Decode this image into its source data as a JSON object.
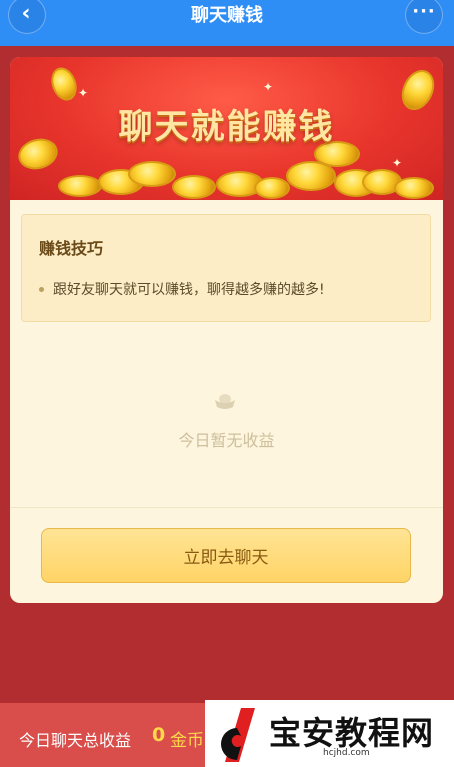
{
  "header": {
    "title": "聊天赚钱",
    "back_icon": "chevron-left-icon",
    "more_icon": "more-dots-icon",
    "color": "#2f8ef5"
  },
  "banner": {
    "title": "聊天就能赚钱"
  },
  "tips": {
    "title": "赚钱技巧",
    "items": [
      "跟好友聊天就可以赚钱，聊得越多赚的越多!"
    ]
  },
  "empty_state": {
    "icon": "ingot-icon",
    "text": "今日暂无收益"
  },
  "actions": {
    "chat_button": "立即去聊天"
  },
  "footer": {
    "label": "今日聊天总收益",
    "value": "0",
    "unit": "金币"
  },
  "watermark": {
    "brand": "宝安教程网",
    "domain": "hcjhd.com"
  }
}
